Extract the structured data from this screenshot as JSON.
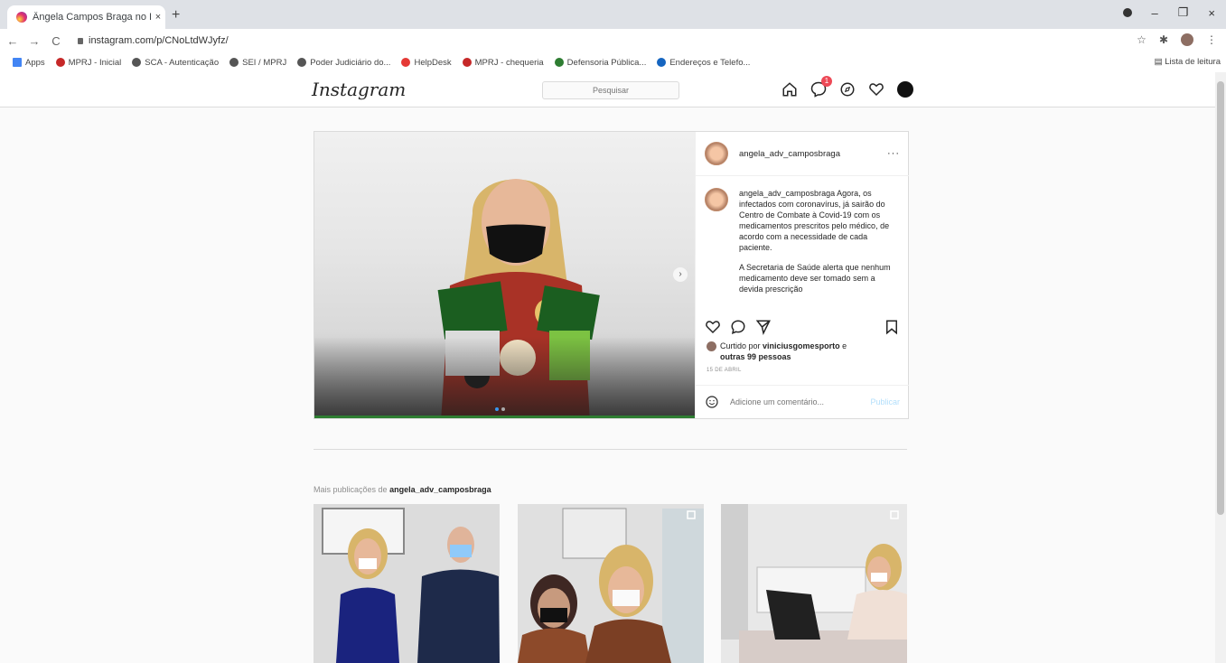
{
  "browser": {
    "tab_title": "Ângela Campos Braga no Instag",
    "tab_close": "×",
    "new_tab": "+",
    "url": "instagram.com/p/CNoLtdWJyfz/",
    "back": "←",
    "forward": "→",
    "reload": "C",
    "bookmarks": [
      {
        "label": "Apps",
        "color": "#4285f4"
      },
      {
        "label": "MPRJ - Inicial",
        "color": "#c62828"
      },
      {
        "label": "SCA - Autenticação",
        "color": "#555555"
      },
      {
        "label": "SEI / MPRJ",
        "color": "#555555"
      },
      {
        "label": "Poder Judiciário do...",
        "color": "#555555"
      },
      {
        "label": "HelpDesk",
        "color": "#e53935"
      },
      {
        "label": "MPRJ - chequeria",
        "color": "#c62828"
      },
      {
        "label": "Defensoria Pública...",
        "color": "#2e7d32"
      },
      {
        "label": "Endereços e Telefo...",
        "color": "#1565c0"
      }
    ],
    "reading_list": "Lista de leitura",
    "window_min": "–",
    "window_max": "❐",
    "window_close": "×"
  },
  "instagram": {
    "logo": "Instagram",
    "search_placeholder": "Pesquisar",
    "search_icon": "search-icon",
    "notification_count": "1"
  },
  "post": {
    "username": "angela_adv_camposbraga",
    "more": "···",
    "caption_paragraph_1": "Agora, os infectados com coronavírus, já sairão do Centro de Combate à Covid-19 com os medicamentos prescritos pelo médico, de acordo com a necessidade de cada paciente.",
    "caption_paragraph_2": "A Secretaria de Saúde alerta que nenhum medicamento deve ser tomado sem a devida prescrição",
    "liked_by_prefix": "Curtido por",
    "liked_by_user": "viniciusgomesporto",
    "liked_by_and": "e",
    "liked_by_others": "outras 99 pessoas",
    "date": "15 DE ABRIL",
    "comment_placeholder": "Adicione um comentário...",
    "publish": "Publicar",
    "next": "›"
  },
  "more_posts": {
    "prefix": "Mais publicações de",
    "username": "angela_adv_camposbraga"
  },
  "colors": {
    "accent": "#3897f0",
    "badge": "#ed4956",
    "border": "#dbdbdb"
  }
}
